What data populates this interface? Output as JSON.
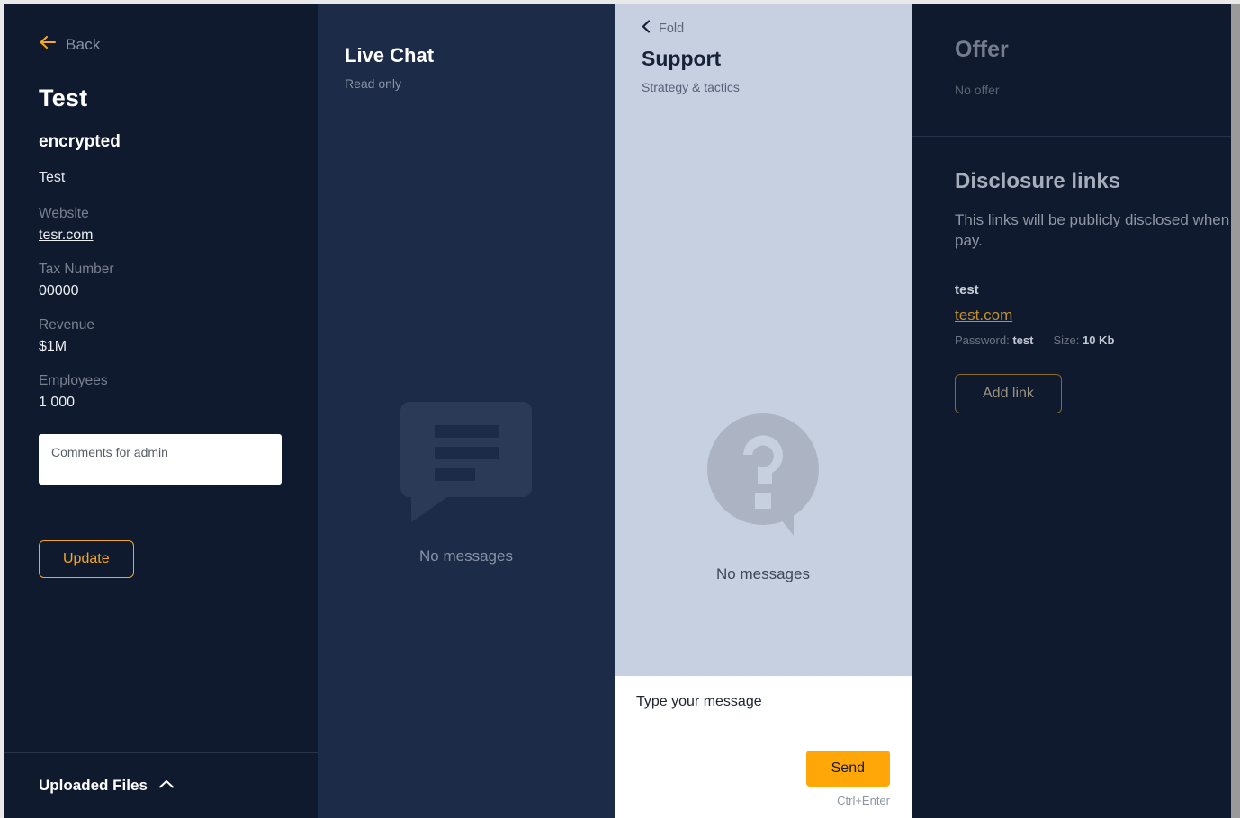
{
  "sidebar": {
    "back": {
      "label": "Back",
      "icon": "arrow-left-icon"
    },
    "org_name": "Test",
    "org_status": "encrypted",
    "org_alias": "Test",
    "fields": [
      {
        "label": "Website",
        "value": "tesr.com",
        "is_link": true
      },
      {
        "label": "Tax Number",
        "value": "00000",
        "is_link": false
      },
      {
        "label": "Revenue",
        "value": "$1M",
        "is_link": false
      },
      {
        "label": "Employees",
        "value": "1 000",
        "is_link": false
      }
    ],
    "comments_placeholder": "Comments for admin",
    "comments_value": "",
    "update_label": "Update",
    "uploaded_files": {
      "label": "Uploaded Files",
      "icon": "chevron-up-icon"
    }
  },
  "live_chat": {
    "title": "Live Chat",
    "subtitle": "Read only",
    "empty_icon": "speech-bubble-icon",
    "empty_text": "No messages"
  },
  "support": {
    "fold_label": "Fold",
    "fold_icon": "chevron-left-icon",
    "title": "Support",
    "subtitle": "Strategy & tactics",
    "empty_icon": "question-bubble-icon",
    "empty_text": "No messages",
    "input_placeholder": "Type your message",
    "input_value": "",
    "send_label": "Send",
    "send_hint": "Ctrl+Enter"
  },
  "right_panel": {
    "offer": {
      "title": "Offer",
      "empty_text": "No offer"
    },
    "disclosure": {
      "title": "Disclosure links",
      "description": "This links will be publicly disclosed when they\npay.",
      "links": [
        {
          "name": "test",
          "url": "test.com",
          "password_label": "Password:",
          "password_value": "test",
          "size_label": "Size:",
          "size_value": "10 Kb"
        }
      ],
      "add_link_label": "Add link"
    }
  },
  "colors": {
    "accent": "#f5a623",
    "send_button": "#ffa709",
    "sidebar_bg": "#101a2e",
    "chat_bg": "#1c2b47",
    "support_bg": "#c7d0e0",
    "link": "#c2902f"
  }
}
